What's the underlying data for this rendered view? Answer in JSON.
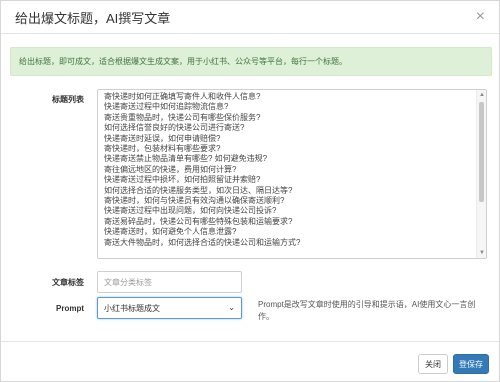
{
  "modal": {
    "title": "给出爆文标题，AI撰写文章",
    "close_glyph": "×"
  },
  "alert": {
    "text": "给出标题，即可成文，适合根据爆文生成文案，用于小红书、公众号等平台，每行一个标题。"
  },
  "form": {
    "titles_label": "标题列表",
    "titles": [
      "寄快递时如何正确填写寄件人和收件人信息?",
      "快递寄送过程中如何追踪物流信息?",
      "寄送贵重物品时，快递公司有哪些保价服务?",
      "如何选择信誉良好的快递公司进行寄送?",
      "快递寄送时延误，如何申请赔偿?",
      "寄快递时，包装材料有哪些要求?",
      "快递寄送禁止物品清单有哪些? 如何避免违规?",
      "寄往偏远地区的快递，费用如何计算?",
      "快递寄送过程中损坏，如何拍照留证并索赔?",
      "如何选择合适的快递服务类型，如次日达、隔日达等?",
      "寄快递时，如何与快递员有效沟通以确保寄送顺利?",
      "快递寄送过程中出现问题，如何向快递公司投诉?",
      "寄送易碎品时，快递公司有哪些特殊包装和运输要求?",
      "快递寄送时，如何避免个人信息泄露?",
      "寄送大件物品时，如何选择合适的快递公司和运输方式?"
    ],
    "tag_label": "文章标签",
    "tag_placeholder": "文章分类标签",
    "prompt_label": "Prompt",
    "prompt_selected": "小红书标题成文",
    "prompt_help": "Prompt是改写文章时使用的引导和提示语，AI使用文心一言创作。"
  },
  "footer": {
    "close_label": "关闭",
    "save_label": "登保存"
  },
  "colors": {
    "alert_bg": "#dff0d8",
    "alert_text": "#3c763d",
    "primary": "#337ab7",
    "focus_border": "#5b9bd5"
  },
  "icons": {
    "close": "close-icon",
    "select_caret": "chevron-down-icon",
    "scroll_up": "arrow-up-icon",
    "scroll_down": "arrow-down-icon"
  }
}
